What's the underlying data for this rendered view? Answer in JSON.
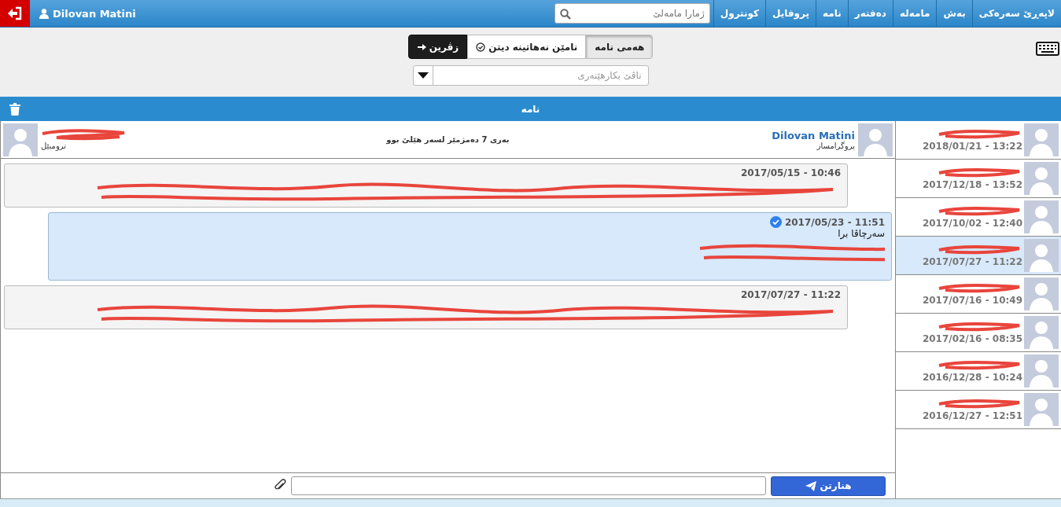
{
  "topbar": {
    "user": "Dilovan Matini",
    "menu": [
      {
        "label": "لاپەڕێ سەرەکی"
      },
      {
        "label": "بەش"
      },
      {
        "label": "مامەلە"
      },
      {
        "label": "دەفتەر"
      },
      {
        "label": "نامە"
      },
      {
        "label": "پروفایل"
      },
      {
        "label": "کونترول"
      }
    ],
    "search": {
      "placeholder": "ژمارا مامەلێ"
    }
  },
  "filters": [
    {
      "label": "هەمی نامە",
      "selected": true,
      "kind": "filter"
    },
    {
      "label": "نامێن نەهاتینە دیتن",
      "selected": false,
      "kind": "unread"
    },
    {
      "label": "زڤرین",
      "selected": false,
      "kind": "back"
    }
  ],
  "user_select": {
    "placeholder": "ناڤێ بکارهێنەری"
  },
  "panel": {
    "title": "نامە"
  },
  "conversation": {
    "me": {
      "name": "Dilovan Matini",
      "role": "پروگرامساز"
    },
    "status": "بەری 7 دەمژمێر لسەر هێلێ بوو",
    "other": {
      "role": "ترومبێل",
      "redacted": true
    }
  },
  "messages": [
    {
      "date": "2017/05/15 - 10:46",
      "mine": false,
      "read": false,
      "redacted": true
    },
    {
      "date": "2017/05/23 - 11:51",
      "mine": true,
      "read": true,
      "text": "سەرچاڤا برا",
      "redacted": true
    },
    {
      "date": "2017/07/27 - 11:22",
      "mine": false,
      "read": false,
      "redacted": true
    }
  ],
  "send_button": "هنارتن",
  "contacts": [
    {
      "date": "2018/01/21 - 13:22",
      "selected": false
    },
    {
      "date": "2017/12/18 - 13:52",
      "selected": false
    },
    {
      "date": "2017/10/02 - 12:40",
      "selected": false
    },
    {
      "date": "2017/07/27 - 11:22",
      "selected": true
    },
    {
      "date": "2017/07/16 - 10:49",
      "selected": false
    },
    {
      "date": "2017/02/16 - 08:35",
      "selected": false
    },
    {
      "date": "2016/12/28 - 10:24",
      "selected": false
    },
    {
      "date": "2016/12/27 - 12:51",
      "selected": false
    }
  ]
}
